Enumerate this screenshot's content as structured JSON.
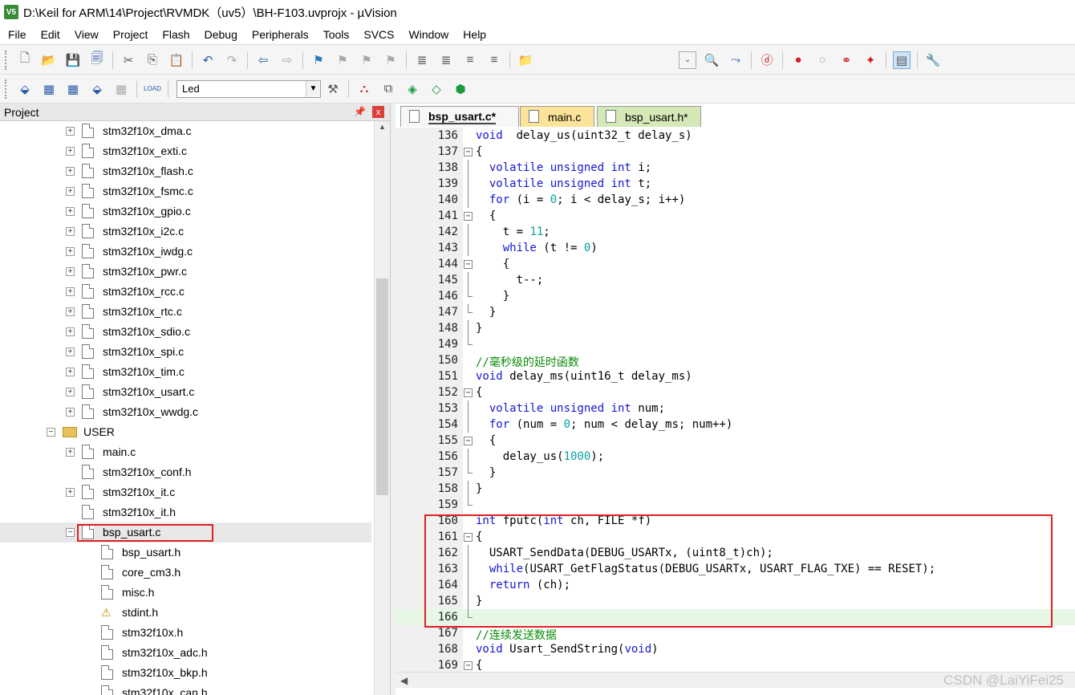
{
  "window": {
    "title": "D:\\Keil for ARM\\14\\Project\\RVMDK（uv5）\\BH-F103.uvprojx - µVision",
    "app_icon_text": "V5"
  },
  "menu": [
    "File",
    "Edit",
    "View",
    "Project",
    "Flash",
    "Debug",
    "Peripherals",
    "Tools",
    "SVCS",
    "Window",
    "Help"
  ],
  "toolbar2": {
    "target": "Led",
    "load_label": "LOAD"
  },
  "project": {
    "title": "Project",
    "pin_icon": "pin-icon",
    "close_label": "x",
    "tree": [
      {
        "label": "stm32f10x_dma.c",
        "level": 2,
        "type": "file",
        "expand": "+"
      },
      {
        "label": "stm32f10x_exti.c",
        "level": 2,
        "type": "file",
        "expand": "+"
      },
      {
        "label": "stm32f10x_flash.c",
        "level": 2,
        "type": "file",
        "expand": "+"
      },
      {
        "label": "stm32f10x_fsmc.c",
        "level": 2,
        "type": "file",
        "expand": "+"
      },
      {
        "label": "stm32f10x_gpio.c",
        "level": 2,
        "type": "file",
        "expand": "+"
      },
      {
        "label": "stm32f10x_i2c.c",
        "level": 2,
        "type": "file",
        "expand": "+"
      },
      {
        "label": "stm32f10x_iwdg.c",
        "level": 2,
        "type": "file",
        "expand": "+"
      },
      {
        "label": "stm32f10x_pwr.c",
        "level": 2,
        "type": "file",
        "expand": "+"
      },
      {
        "label": "stm32f10x_rcc.c",
        "level": 2,
        "type": "file",
        "expand": "+"
      },
      {
        "label": "stm32f10x_rtc.c",
        "level": 2,
        "type": "file",
        "expand": "+"
      },
      {
        "label": "stm32f10x_sdio.c",
        "level": 2,
        "type": "file",
        "expand": "+"
      },
      {
        "label": "stm32f10x_spi.c",
        "level": 2,
        "type": "file",
        "expand": "+"
      },
      {
        "label": "stm32f10x_tim.c",
        "level": 2,
        "type": "file",
        "expand": "+"
      },
      {
        "label": "stm32f10x_usart.c",
        "level": 2,
        "type": "file",
        "expand": "+"
      },
      {
        "label": "stm32f10x_wwdg.c",
        "level": 2,
        "type": "file",
        "expand": "+"
      },
      {
        "label": "USER",
        "level": 1,
        "type": "folder",
        "expand": "−"
      },
      {
        "label": "main.c",
        "level": 2,
        "type": "file",
        "expand": "+"
      },
      {
        "label": "stm32f10x_conf.h",
        "level": 2,
        "type": "file",
        "expand": ""
      },
      {
        "label": "stm32f10x_it.c",
        "level": 2,
        "type": "file",
        "expand": "+"
      },
      {
        "label": "stm32f10x_it.h",
        "level": 2,
        "type": "file",
        "expand": ""
      },
      {
        "label": "bsp_usart.c",
        "level": 2,
        "type": "file",
        "expand": "−",
        "selected": true
      },
      {
        "label": "bsp_usart.h",
        "level": 3,
        "type": "file",
        "expand": ""
      },
      {
        "label": "core_cm3.h",
        "level": 3,
        "type": "file",
        "expand": ""
      },
      {
        "label": "misc.h",
        "level": 3,
        "type": "file",
        "expand": ""
      },
      {
        "label": "stdint.h",
        "level": 3,
        "type": "warn",
        "expand": ""
      },
      {
        "label": "stm32f10x.h",
        "level": 3,
        "type": "file",
        "expand": ""
      },
      {
        "label": "stm32f10x_adc.h",
        "level": 3,
        "type": "file",
        "expand": ""
      },
      {
        "label": "stm32f10x_bkp.h",
        "level": 3,
        "type": "file",
        "expand": ""
      },
      {
        "label": "stm32f10x_can.h",
        "level": 3,
        "type": "file",
        "expand": ""
      }
    ]
  },
  "editor": {
    "tabs": [
      {
        "label": "bsp_usart.c*",
        "style": "active"
      },
      {
        "label": "main.c",
        "style": "yellow"
      },
      {
        "label": "bsp_usart.h*",
        "style": "green"
      }
    ],
    "lines": [
      {
        "n": "136",
        "fold": "",
        "tokens": [
          [
            "kw",
            "void"
          ],
          [
            "",
            "  delay_us(uint32_t delay_s)"
          ]
        ]
      },
      {
        "n": "137",
        "fold": "box",
        "tokens": [
          [
            "",
            "{"
          ]
        ]
      },
      {
        "n": "138",
        "fold": "line",
        "tokens": [
          [
            "",
            "  "
          ],
          [
            "kw",
            "volatile unsigned int"
          ],
          [
            "",
            " i;"
          ]
        ]
      },
      {
        "n": "139",
        "fold": "line",
        "tokens": [
          [
            "",
            "  "
          ],
          [
            "kw",
            "volatile unsigned int"
          ],
          [
            "",
            " t;"
          ]
        ]
      },
      {
        "n": "140",
        "fold": "line",
        "tokens": [
          [
            "",
            "  "
          ],
          [
            "kw",
            "for"
          ],
          [
            "",
            " (i = "
          ],
          [
            "num",
            "0"
          ],
          [
            "",
            "; i < delay_s; i++)"
          ]
        ]
      },
      {
        "n": "141",
        "fold": "box",
        "tokens": [
          [
            "",
            "  {"
          ]
        ]
      },
      {
        "n": "142",
        "fold": "line",
        "tokens": [
          [
            "",
            "    t = "
          ],
          [
            "num",
            "11"
          ],
          [
            "",
            ";"
          ]
        ]
      },
      {
        "n": "143",
        "fold": "line",
        "tokens": [
          [
            "",
            "    "
          ],
          [
            "kw",
            "while"
          ],
          [
            "",
            " (t != "
          ],
          [
            "num",
            "0"
          ],
          [
            "",
            ")"
          ]
        ]
      },
      {
        "n": "144",
        "fold": "box",
        "tokens": [
          [
            "",
            "    {"
          ]
        ]
      },
      {
        "n": "145",
        "fold": "line",
        "tokens": [
          [
            "",
            "      t--;"
          ]
        ]
      },
      {
        "n": "146",
        "fold": "end",
        "tokens": [
          [
            "",
            "    }"
          ]
        ]
      },
      {
        "n": "147",
        "fold": "end",
        "tokens": [
          [
            "",
            "  }"
          ]
        ]
      },
      {
        "n": "148",
        "fold": "line",
        "tokens": [
          [
            "",
            "}"
          ]
        ]
      },
      {
        "n": "149",
        "fold": "end",
        "tokens": [
          [
            "",
            ""
          ]
        ]
      },
      {
        "n": "150",
        "fold": "",
        "tokens": [
          [
            "cm",
            "//毫秒级的延时函数"
          ]
        ]
      },
      {
        "n": "151",
        "fold": "",
        "tokens": [
          [
            "kw",
            "void"
          ],
          [
            "",
            " delay_ms(uint16_t delay_ms)"
          ]
        ]
      },
      {
        "n": "152",
        "fold": "box",
        "tokens": [
          [
            "",
            "{"
          ]
        ]
      },
      {
        "n": "153",
        "fold": "line",
        "tokens": [
          [
            "",
            "  "
          ],
          [
            "kw",
            "volatile unsigned int"
          ],
          [
            "",
            " num;"
          ]
        ]
      },
      {
        "n": "154",
        "fold": "line",
        "tokens": [
          [
            "",
            "  "
          ],
          [
            "kw",
            "for"
          ],
          [
            "",
            " (num = "
          ],
          [
            "num",
            "0"
          ],
          [
            "",
            "; num < delay_ms; num++)"
          ]
        ]
      },
      {
        "n": "155",
        "fold": "box",
        "tokens": [
          [
            "",
            "  {"
          ]
        ]
      },
      {
        "n": "156",
        "fold": "line",
        "tokens": [
          [
            "",
            "    delay_us("
          ],
          [
            "num",
            "1000"
          ],
          [
            "",
            ");"
          ]
        ]
      },
      {
        "n": "157",
        "fold": "end",
        "tokens": [
          [
            "",
            "  }"
          ]
        ]
      },
      {
        "n": "158",
        "fold": "line",
        "tokens": [
          [
            "",
            "}"
          ]
        ]
      },
      {
        "n": "159",
        "fold": "end",
        "tokens": [
          [
            "",
            ""
          ]
        ]
      },
      {
        "n": "160",
        "fold": "",
        "tokens": [
          [
            "kw",
            "int"
          ],
          [
            "",
            " fputc("
          ],
          [
            "kw",
            "int"
          ],
          [
            "",
            " ch, FILE *f)"
          ]
        ]
      },
      {
        "n": "161",
        "fold": "box",
        "tokens": [
          [
            "",
            "{"
          ]
        ]
      },
      {
        "n": "162",
        "fold": "line",
        "tokens": [
          [
            "",
            "  USART_SendData(DEBUG_USARTx, (uint8_t)ch);"
          ]
        ]
      },
      {
        "n": "163",
        "fold": "line",
        "tokens": [
          [
            "",
            "  "
          ],
          [
            "kw",
            "while"
          ],
          [
            "",
            "(USART_GetFlagStatus(DEBUG_USARTx, USART_FLAG_TXE) == RESET);"
          ]
        ]
      },
      {
        "n": "164",
        "fold": "line",
        "tokens": [
          [
            "",
            "  "
          ],
          [
            "kw",
            "return"
          ],
          [
            "",
            " (ch);"
          ]
        ]
      },
      {
        "n": "165",
        "fold": "line",
        "tokens": [
          [
            "",
            "}"
          ]
        ]
      },
      {
        "n": "166",
        "fold": "end",
        "current": true,
        "tokens": [
          [
            "",
            ""
          ]
        ]
      },
      {
        "n": "167",
        "fold": "",
        "tokens": [
          [
            "cm",
            "//连续发送数据"
          ]
        ]
      },
      {
        "n": "168",
        "fold": "",
        "tokens": [
          [
            "kw",
            "void"
          ],
          [
            "",
            " Usart_SendString("
          ],
          [
            "kw",
            "void"
          ],
          [
            "",
            ")"
          ]
        ]
      },
      {
        "n": "169",
        "fold": "box",
        "tokens": [
          [
            "",
            "{"
          ]
        ]
      }
    ]
  },
  "watermark": "CSDN @LaiYiFei25",
  "colors": {
    "highlight": "#e02020",
    "keyword": "#1515d8",
    "number": "#08a0a0",
    "comment": "#0a8a0a"
  }
}
